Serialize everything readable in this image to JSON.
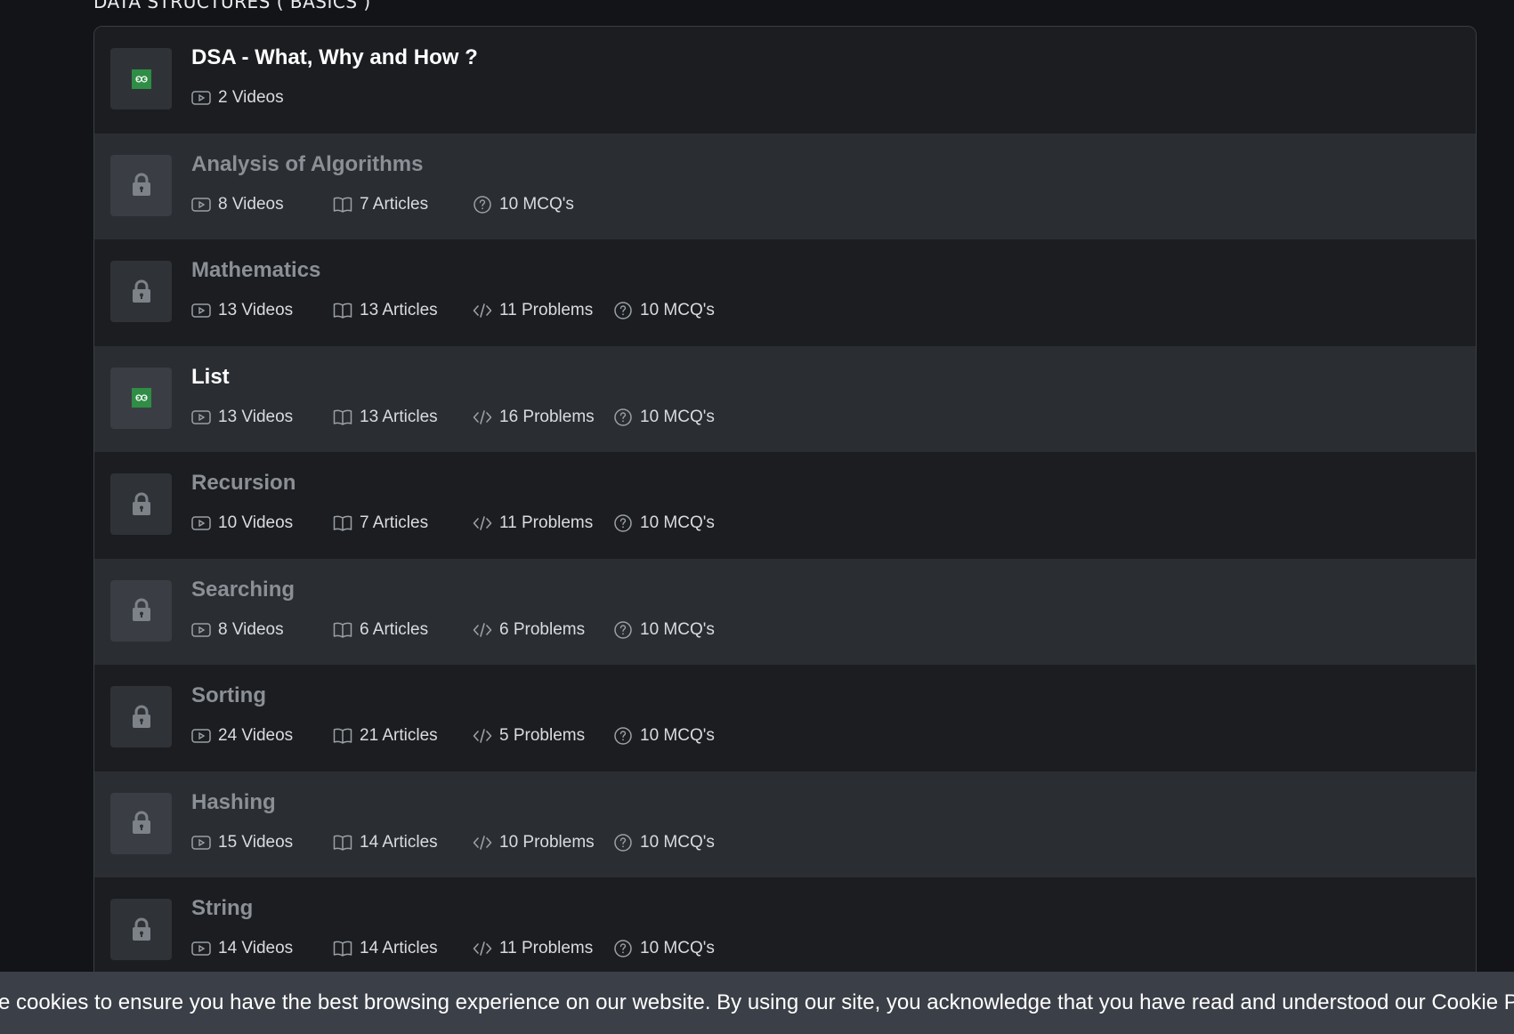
{
  "section": {
    "title": "DATA STRUCTURES ( BASICS )"
  },
  "modules": [
    {
      "title": "DSA - What, Why and How ?",
      "locked": false,
      "videos": "2 Videos",
      "articles": null,
      "problems": null,
      "mcqs": null
    },
    {
      "title": "Analysis of Algorithms",
      "locked": true,
      "videos": "8 Videos",
      "articles": "7 Articles",
      "problems": null,
      "mcqs": "10 MCQ's"
    },
    {
      "title": "Mathematics",
      "locked": true,
      "videos": "13 Videos",
      "articles": "13 Articles",
      "problems": "11 Problems",
      "mcqs": "10 MCQ's"
    },
    {
      "title": "List",
      "locked": false,
      "videos": "13 Videos",
      "articles": "13 Articles",
      "problems": "16 Problems",
      "mcqs": "10 MCQ's"
    },
    {
      "title": "Recursion",
      "locked": true,
      "videos": "10 Videos",
      "articles": "7 Articles",
      "problems": "11 Problems",
      "mcqs": "10 MCQ's"
    },
    {
      "title": "Searching",
      "locked": true,
      "videos": "8 Videos",
      "articles": "6 Articles",
      "problems": "6 Problems",
      "mcqs": "10 MCQ's"
    },
    {
      "title": "Sorting",
      "locked": true,
      "videos": "24 Videos",
      "articles": "21 Articles",
      "problems": "5 Problems",
      "mcqs": "10 MCQ's"
    },
    {
      "title": "Hashing",
      "locked": true,
      "videos": "15 Videos",
      "articles": "14 Articles",
      "problems": "10 Problems",
      "mcqs": "10 MCQ's"
    },
    {
      "title": "String",
      "locked": true,
      "videos": "14 Videos",
      "articles": "14 Articles",
      "problems": "11 Problems",
      "mcqs": "10 MCQ's"
    }
  ],
  "cookie_banner": {
    "text": "se cookies to ensure you have the best browsing experience on our website. By using our site, you acknowledge that you have read and understood our Cookie P"
  },
  "icons": {
    "unlocked_thumb": "gfg-logo-icon",
    "locked_thumb": "lock-icon",
    "videos": "video-play-icon",
    "articles": "book-open-icon",
    "problems": "code-icon",
    "mcqs": "question-circle-icon"
  },
  "colors": {
    "background": "#121418",
    "row_dark": "#1b1d21",
    "row_light": "#2a2d32",
    "brand_green": "#2f8d46",
    "locked_title": "#8b9096",
    "cookie_bar": "#3b3f47"
  }
}
